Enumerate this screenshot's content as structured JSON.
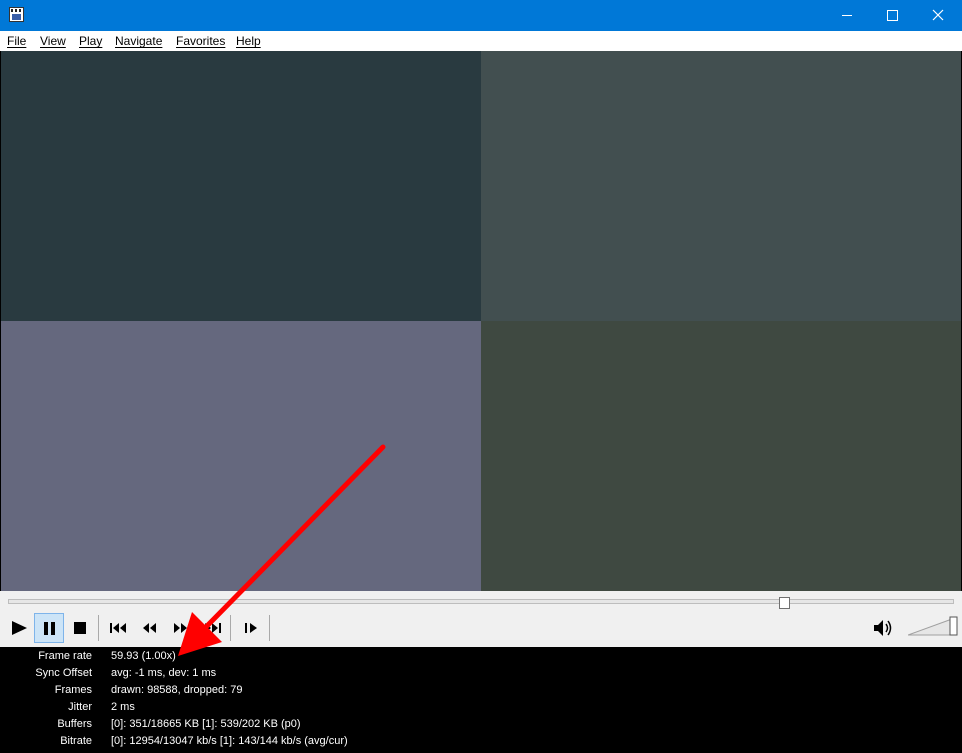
{
  "window": {
    "app_icon": "film-clapper-icon",
    "controls": [
      "minimize-icon",
      "maximize-icon",
      "close-icon"
    ]
  },
  "menu": {
    "items": [
      {
        "label": "File"
      },
      {
        "label": "View"
      },
      {
        "label": "Play"
      },
      {
        "label": "Navigate"
      },
      {
        "label": "Favorites"
      },
      {
        "label": "Help"
      }
    ]
  },
  "video": {
    "quadrant_colors": [
      "#293a40",
      "#424f50",
      "#65687e",
      "#3f4941"
    ]
  },
  "controls": {
    "seek_position": 0.82,
    "state": "paused",
    "buttons": [
      "play-icon",
      "pause-icon",
      "stop-icon",
      "skip-back-icon",
      "rewind-icon",
      "fast-forward-icon",
      "skip-forward-icon",
      "frame-step-icon"
    ],
    "volume_icon": "speaker-icon",
    "volume_level": 1.0
  },
  "stats": {
    "rows": [
      {
        "label": "Frame rate",
        "value": "59.93 (1.00x)"
      },
      {
        "label": "Sync Offset",
        "value": "avg: -1 ms, dev: 1 ms"
      },
      {
        "label": "Frames",
        "value": "drawn: 98588, dropped: 79"
      },
      {
        "label": "Jitter",
        "value": "2 ms"
      },
      {
        "label": "Buffers",
        "value": "[0]: 351/18665 KB [1]: 539/202 KB (p0)"
      },
      {
        "label": "Bitrate",
        "value": "[0]: 12954/13047 kb/s [1]: 143/144 kb/s (avg/cur)"
      }
    ]
  },
  "annotation": {
    "color": "#ff0000"
  }
}
